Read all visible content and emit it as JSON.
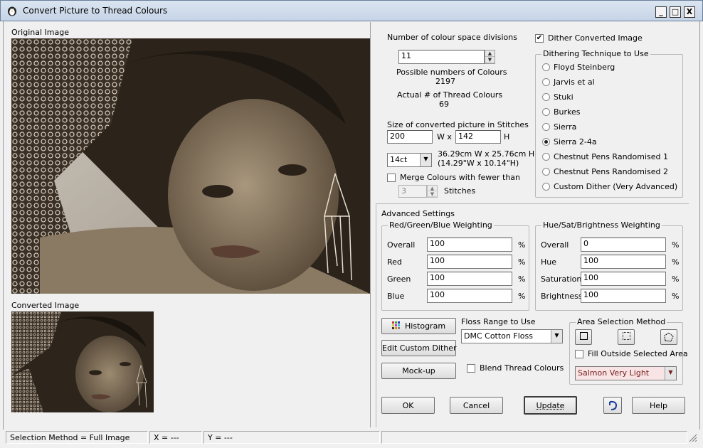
{
  "window": {
    "title": "Convert Picture to Thread Colours",
    "min_label": "_",
    "max_label": "□",
    "close_label": "X"
  },
  "left": {
    "original_label": "Original Image",
    "converted_label": "Converted Image"
  },
  "colour": {
    "divisions_label": "Number of colour space divisions",
    "divisions_value": "11",
    "possible_label": "Possible numbers of Colours",
    "possible_value": "2197",
    "actual_label": "Actual # of Thread Colours",
    "actual_value": "69"
  },
  "size": {
    "label": "Size of converted picture in Stitches",
    "width": "200",
    "x_label": "W x",
    "height": "142",
    "h_label": "H",
    "count": "14ct",
    "dim_cm": "36.29cm W x 25.76cm H",
    "dim_in": "(14.29\"W x 10.14\"H)"
  },
  "merge": {
    "label": "Merge Colours with fewer than",
    "value": "3",
    "unit": "Stitches",
    "checked": false
  },
  "dither": {
    "checkbox_label": "Dither Converted Image",
    "checked": true,
    "group_label": "Dithering Technique to Use",
    "options": [
      "Floyd Steinberg",
      "Jarvis et al",
      "Stuki",
      "Burkes",
      "Sierra",
      "Sierra 2-4a",
      "Chestnut Pens Randomised 1",
      "Chestnut Pens Randomised 2",
      "Custom Dither (Very Advanced)"
    ],
    "selected": "Sierra 2-4a"
  },
  "advanced": {
    "label": "Advanced Settings",
    "rgb": {
      "title": "Red/Green/Blue Weighting",
      "rows": [
        {
          "label": "Overall",
          "value": "100"
        },
        {
          "label": "Red",
          "value": "100"
        },
        {
          "label": "Green",
          "value": "100"
        },
        {
          "label": "Blue",
          "value": "100"
        }
      ]
    },
    "hsb": {
      "title": "Hue/Sat/Brightness Weighting",
      "rows": [
        {
          "label": "Overall",
          "value": "0"
        },
        {
          "label": "Hue",
          "value": "100"
        },
        {
          "label": "Saturation",
          "value": "100"
        },
        {
          "label": "Brightness",
          "value": "100"
        }
      ]
    },
    "pct": "%"
  },
  "buttons": {
    "histogram": "Histogram",
    "edit_custom": "Edit Custom Dither",
    "mockup": "Mock-up",
    "ok": "OK",
    "cancel": "Cancel",
    "update": "Update",
    "help": "Help"
  },
  "floss": {
    "label": "Floss Range to Use",
    "value": "DMC Cotton Floss",
    "blend_label": "Blend Thread Colours",
    "blend_checked": false
  },
  "area": {
    "label": "Area Selection Method",
    "fill_label": "Fill Outside Selected Area",
    "fill_checked": false,
    "colour_value": "Salmon Very Light",
    "colour_bg": "#f8e4e4"
  },
  "status": {
    "method": "Selection Method = Full Image",
    "x": "X = ---",
    "y": "Y = ---"
  },
  "colors": {
    "title_bg": "#c9d7ea",
    "sepia_dark": "#2e261d",
    "sepia_light": "#bfb29c"
  }
}
